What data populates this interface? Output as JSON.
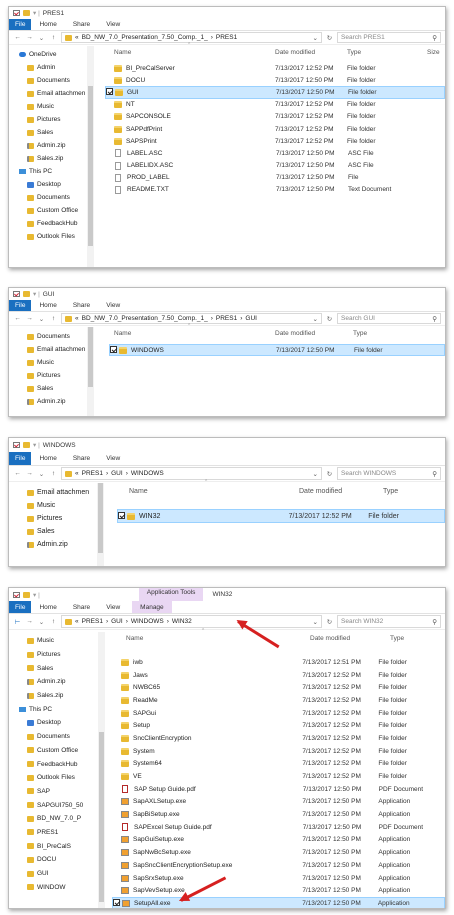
{
  "windows": [
    {
      "title": "PRES1",
      "tabs": [
        "File",
        "Home",
        "Share",
        "View"
      ],
      "path": [
        "BD_NW_7.0_Presentation_7.50_Comp._1_",
        "PRES1"
      ],
      "search": "Search PRES1",
      "columns": {
        "name": "Name",
        "date": "Date modified",
        "type": "Type",
        "size": "Size"
      },
      "nav": [
        {
          "label": "OneDrive",
          "icon": "onedrive-icon"
        },
        {
          "label": "Admin",
          "icon": "folder-icon"
        },
        {
          "label": "Documents",
          "icon": "folder-icon"
        },
        {
          "label": "Email attachmen",
          "icon": "folder-icon"
        },
        {
          "label": "Music",
          "icon": "folder-icon"
        },
        {
          "label": "Pictures",
          "icon": "folder-icon"
        },
        {
          "label": "Sales",
          "icon": "folder-icon"
        },
        {
          "label": "Admin.zip",
          "icon": "zip-icon"
        },
        {
          "label": "Sales.zip",
          "icon": "zip-icon"
        },
        {
          "label": "This PC",
          "icon": "pc-icon"
        },
        {
          "label": "Desktop",
          "icon": "desktop-icon"
        },
        {
          "label": "Documents",
          "icon": "folder-icon"
        },
        {
          "label": "Custom Office",
          "icon": "folder-icon"
        },
        {
          "label": "FeedbackHub",
          "icon": "folder-icon"
        },
        {
          "label": "Outlook Files",
          "icon": "folder-icon"
        }
      ],
      "rows": [
        {
          "name": "BI_PreCalServer",
          "date": "7/13/2017 12:52 PM",
          "type": "File folder",
          "icon": "folder"
        },
        {
          "name": "DOCU",
          "date": "7/13/2017 12:50 PM",
          "type": "File folder",
          "icon": "folder"
        },
        {
          "name": "GUI",
          "date": "7/13/2017 12:50 PM",
          "type": "File folder",
          "icon": "folder",
          "selected": true
        },
        {
          "name": "NT",
          "date": "7/13/2017 12:52 PM",
          "type": "File folder",
          "icon": "folder"
        },
        {
          "name": "SAPCONSOLE",
          "date": "7/13/2017 12:52 PM",
          "type": "File folder",
          "icon": "folder"
        },
        {
          "name": "SAPPdfPrint",
          "date": "7/13/2017 12:52 PM",
          "type": "File folder",
          "icon": "folder"
        },
        {
          "name": "SAPSPrint",
          "date": "7/13/2017 12:52 PM",
          "type": "File folder",
          "icon": "folder"
        },
        {
          "name": "LABEL.ASC",
          "date": "7/13/2017 12:50 PM",
          "type": "ASC File",
          "icon": "file"
        },
        {
          "name": "LABELIDX.ASC",
          "date": "7/13/2017 12:50 PM",
          "type": "ASC File",
          "icon": "file"
        },
        {
          "name": "PROD_LABEL",
          "date": "7/13/2017 12:50 PM",
          "type": "File",
          "icon": "file"
        },
        {
          "name": "README.TXT",
          "date": "7/13/2017 12:50 PM",
          "type": "Text Document",
          "icon": "file"
        }
      ]
    },
    {
      "title": "GUI",
      "tabs": [
        "File",
        "Home",
        "Share",
        "View"
      ],
      "path": [
        "BD_NW_7.0_Presentation_7.50_Comp._1_",
        "PRES1",
        "GUI"
      ],
      "search": "Search GUI",
      "columns": {
        "name": "Name",
        "date": "Date modified",
        "type": "Type"
      },
      "nav": [
        {
          "label": "Documents",
          "icon": "folder-icon"
        },
        {
          "label": "Email attachmen",
          "icon": "folder-icon"
        },
        {
          "label": "Music",
          "icon": "folder-icon"
        },
        {
          "label": "Pictures",
          "icon": "folder-icon"
        },
        {
          "label": "Sales",
          "icon": "folder-icon"
        },
        {
          "label": "Admin.zip",
          "icon": "zip-icon"
        }
      ],
      "rows": [
        {
          "name": "WINDOWS",
          "date": "7/13/2017 12:50 PM",
          "type": "File folder",
          "icon": "folder",
          "selected": true
        }
      ]
    },
    {
      "title": "WINDOWS",
      "tabs": [
        "File",
        "Home",
        "Share",
        "View"
      ],
      "path": [
        "PRES1",
        "GUI",
        "WINDOWS"
      ],
      "search": "Search WINDOWS",
      "columns": {
        "name": "Name",
        "date": "Date modified",
        "type": "Type"
      },
      "nav": [
        {
          "label": "Email attachmen",
          "icon": "folder-icon"
        },
        {
          "label": "Music",
          "icon": "folder-icon"
        },
        {
          "label": "Pictures",
          "icon": "folder-icon"
        },
        {
          "label": "Sales",
          "icon": "folder-icon"
        },
        {
          "label": "Admin.zip",
          "icon": "zip-icon"
        }
      ],
      "rows": [
        {
          "name": "WIN32",
          "date": "7/13/2017 12:52 PM",
          "type": "File folder",
          "icon": "folder",
          "selected": true
        }
      ]
    },
    {
      "title": "WIN32",
      "context_tab": "Application Tools",
      "tabs": [
        "File",
        "Home",
        "Share",
        "View",
        "Manage"
      ],
      "path": [
        "PRES1",
        "GUI",
        "WINDOWS",
        "WIN32"
      ],
      "search": "Search WIN32",
      "columns": {
        "name": "Name",
        "date": "Date modified",
        "type": "Type"
      },
      "nav": [
        {
          "label": "Music",
          "icon": "folder-icon"
        },
        {
          "label": "Pictures",
          "icon": "folder-icon"
        },
        {
          "label": "Sales",
          "icon": "folder-icon"
        },
        {
          "label": "Admin.zip",
          "icon": "zip-icon"
        },
        {
          "label": "Sales.zip",
          "icon": "zip-icon"
        },
        {
          "label": "This PC",
          "icon": "pc-icon"
        },
        {
          "label": "Desktop",
          "icon": "desktop-icon"
        },
        {
          "label": "Documents",
          "icon": "folder-icon"
        },
        {
          "label": "Custom Office",
          "icon": "folder-icon"
        },
        {
          "label": "FeedbackHub",
          "icon": "folder-icon"
        },
        {
          "label": "Outlook Files",
          "icon": "folder-icon"
        },
        {
          "label": "SAP",
          "icon": "folder-icon"
        },
        {
          "label": "SAPGUI750_50",
          "icon": "folder-icon"
        },
        {
          "label": "BD_NW_7.0_P",
          "icon": "folder-icon"
        },
        {
          "label": "PRES1",
          "icon": "folder-icon"
        },
        {
          "label": "BI_PreCalS",
          "icon": "folder-icon"
        },
        {
          "label": "DOCU",
          "icon": "folder-icon"
        },
        {
          "label": "GUI",
          "icon": "folder-icon"
        },
        {
          "label": "WINDOW",
          "icon": "folder-icon"
        }
      ],
      "rows": [
        {
          "name": "iwb",
          "date": "7/13/2017 12:51 PM",
          "type": "File folder",
          "icon": "folder"
        },
        {
          "name": "Jaws",
          "date": "7/13/2017 12:52 PM",
          "type": "File folder",
          "icon": "folder"
        },
        {
          "name": "NWBC65",
          "date": "7/13/2017 12:52 PM",
          "type": "File folder",
          "icon": "folder"
        },
        {
          "name": "ReadMe",
          "date": "7/13/2017 12:52 PM",
          "type": "File folder",
          "icon": "folder"
        },
        {
          "name": "SAPGui",
          "date": "7/13/2017 12:52 PM",
          "type": "File folder",
          "icon": "folder"
        },
        {
          "name": "Setup",
          "date": "7/13/2017 12:52 PM",
          "type": "File folder",
          "icon": "folder"
        },
        {
          "name": "SncClientEncryption",
          "date": "7/13/2017 12:52 PM",
          "type": "File folder",
          "icon": "folder"
        },
        {
          "name": "System",
          "date": "7/13/2017 12:52 PM",
          "type": "File folder",
          "icon": "folder"
        },
        {
          "name": "System64",
          "date": "7/13/2017 12:52 PM",
          "type": "File folder",
          "icon": "folder"
        },
        {
          "name": "VE",
          "date": "7/13/2017 12:52 PM",
          "type": "File folder",
          "icon": "folder"
        },
        {
          "name": "SAP Setup Guide.pdf",
          "date": "7/13/2017 12:50 PM",
          "type": "PDF Document",
          "icon": "pdf"
        },
        {
          "name": "SapAXLSetup.exe",
          "date": "7/13/2017 12:50 PM",
          "type": "Application",
          "icon": "exe"
        },
        {
          "name": "SapBiSetup.exe",
          "date": "7/13/2017 12:50 PM",
          "type": "Application",
          "icon": "exe"
        },
        {
          "name": "SAPExcel Setup Guide.pdf",
          "date": "7/13/2017 12:50 PM",
          "type": "PDF Document",
          "icon": "pdf"
        },
        {
          "name": "SapGuiSetup.exe",
          "date": "7/13/2017 12:50 PM",
          "type": "Application",
          "icon": "exe"
        },
        {
          "name": "SapNwBcSetup.exe",
          "date": "7/13/2017 12:50 PM",
          "type": "Application",
          "icon": "exe"
        },
        {
          "name": "SapSncClientEncryptionSetup.exe",
          "date": "7/13/2017 12:50 PM",
          "type": "Application",
          "icon": "exe"
        },
        {
          "name": "SapSrxSetup.exe",
          "date": "7/13/2017 12:50 PM",
          "type": "Application",
          "icon": "exe"
        },
        {
          "name": "SapVevSetup.exe",
          "date": "7/13/2017 12:50 PM",
          "type": "Application",
          "icon": "exe"
        },
        {
          "name": "SetupAll.exe",
          "date": "7/13/2017 12:50 PM",
          "type": "Application",
          "icon": "exe",
          "selected": true
        }
      ]
    }
  ],
  "colors": {
    "selection": "#cce8ff",
    "file_tab": "#1a6fc0",
    "annotation_arrow": "#d62020",
    "folder": "#e8b931"
  }
}
